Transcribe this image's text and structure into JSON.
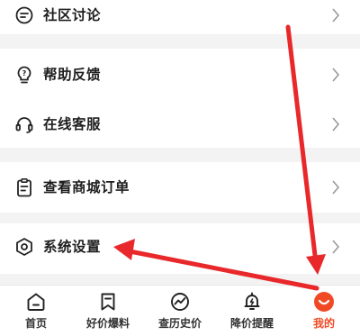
{
  "menu": {
    "community": "社区讨论",
    "help_feedback": "帮助反馈",
    "online_service": "在线客服",
    "mall_orders": "查看商城订单",
    "system_settings": "系统设置"
  },
  "tabbar": {
    "tabs": [
      {
        "label": "首页",
        "icon": "home-icon"
      },
      {
        "label": "好价爆料",
        "icon": "bookmark-icon"
      },
      {
        "label": "查历史价",
        "icon": "price-history-icon"
      },
      {
        "label": "降价提醒",
        "icon": "bell-icon"
      },
      {
        "label": "我的",
        "icon": "profile-icon"
      }
    ],
    "active_index": 4
  },
  "colors": {
    "accent": "#f04a24",
    "arrow": "#e8282a",
    "background": "#f3f3f3"
  }
}
